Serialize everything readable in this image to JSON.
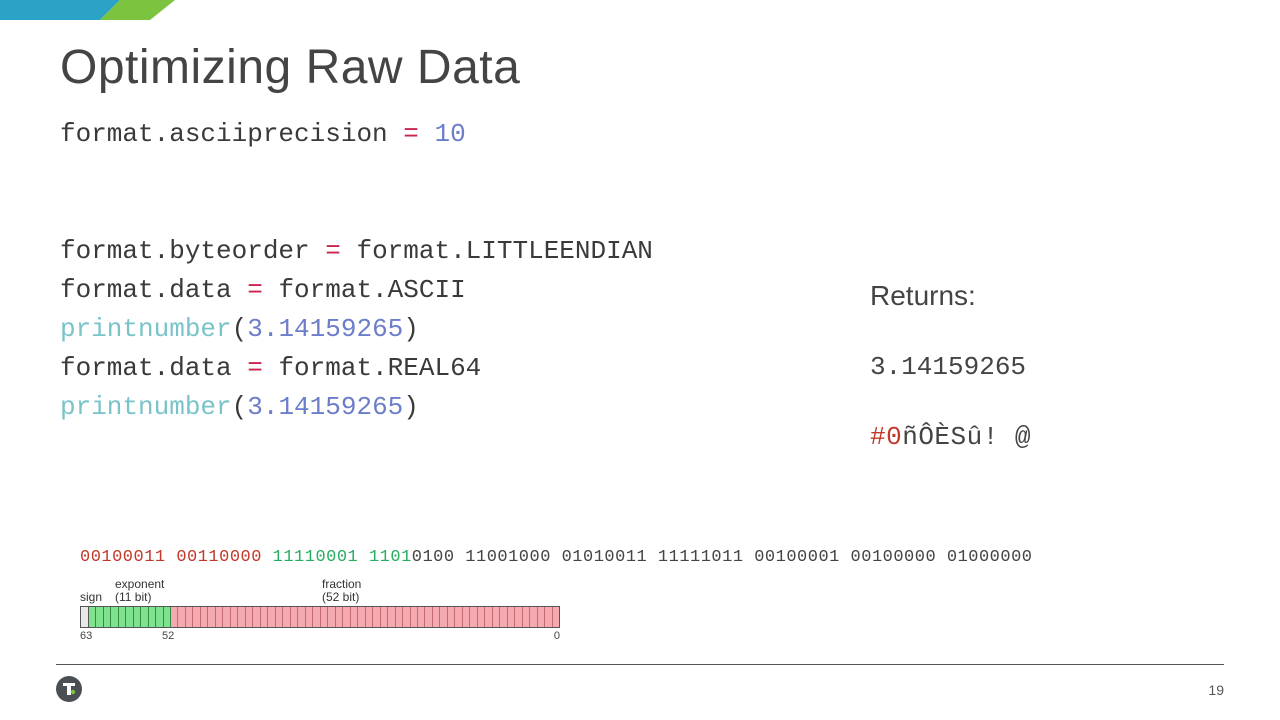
{
  "title": "Optimizing Raw Data",
  "code": {
    "l1": {
      "a": "format.asciiprecision ",
      "op": "=",
      "b": " ",
      "num": "10"
    },
    "l2": {
      "a": "format.byteorder ",
      "op": "=",
      "b": " format.LITTLEENDIAN"
    },
    "l3": {
      "a": "format.data ",
      "op": "=",
      "b": " format.ASCII"
    },
    "l4": {
      "fn": "printnumber",
      "open": "(",
      "num": "3.14159265",
      "close": ")"
    },
    "l5": {
      "a": "format.data ",
      "op": "=",
      "b": " format.REAL64"
    },
    "l6": {
      "fn": "printnumber",
      "open": "(",
      "num": "3.14159265",
      "close": ")"
    }
  },
  "returns": {
    "label": "Returns:",
    "ascii": "3.14159265",
    "binary_prefix": "#0",
    "binary_rest": "ñÔÈSû! @"
  },
  "bits": {
    "g1_red": "00100011 00110000 ",
    "g2_green_a": "1",
    "g2_green_b": "1110001 ",
    "g3_green": "1101",
    "g3_rest": "0100 11001000 01010011 11111011 00100001 00100000 01000000"
  },
  "diagram": {
    "sign": "sign",
    "exponent_line1": "exponent",
    "exponent_line2": "(11 bit)",
    "fraction_line1": "fraction",
    "fraction_line2": "(52 bit)",
    "tick_left": "63",
    "tick_mid": "52",
    "tick_right": "0"
  },
  "page_number": "19"
}
